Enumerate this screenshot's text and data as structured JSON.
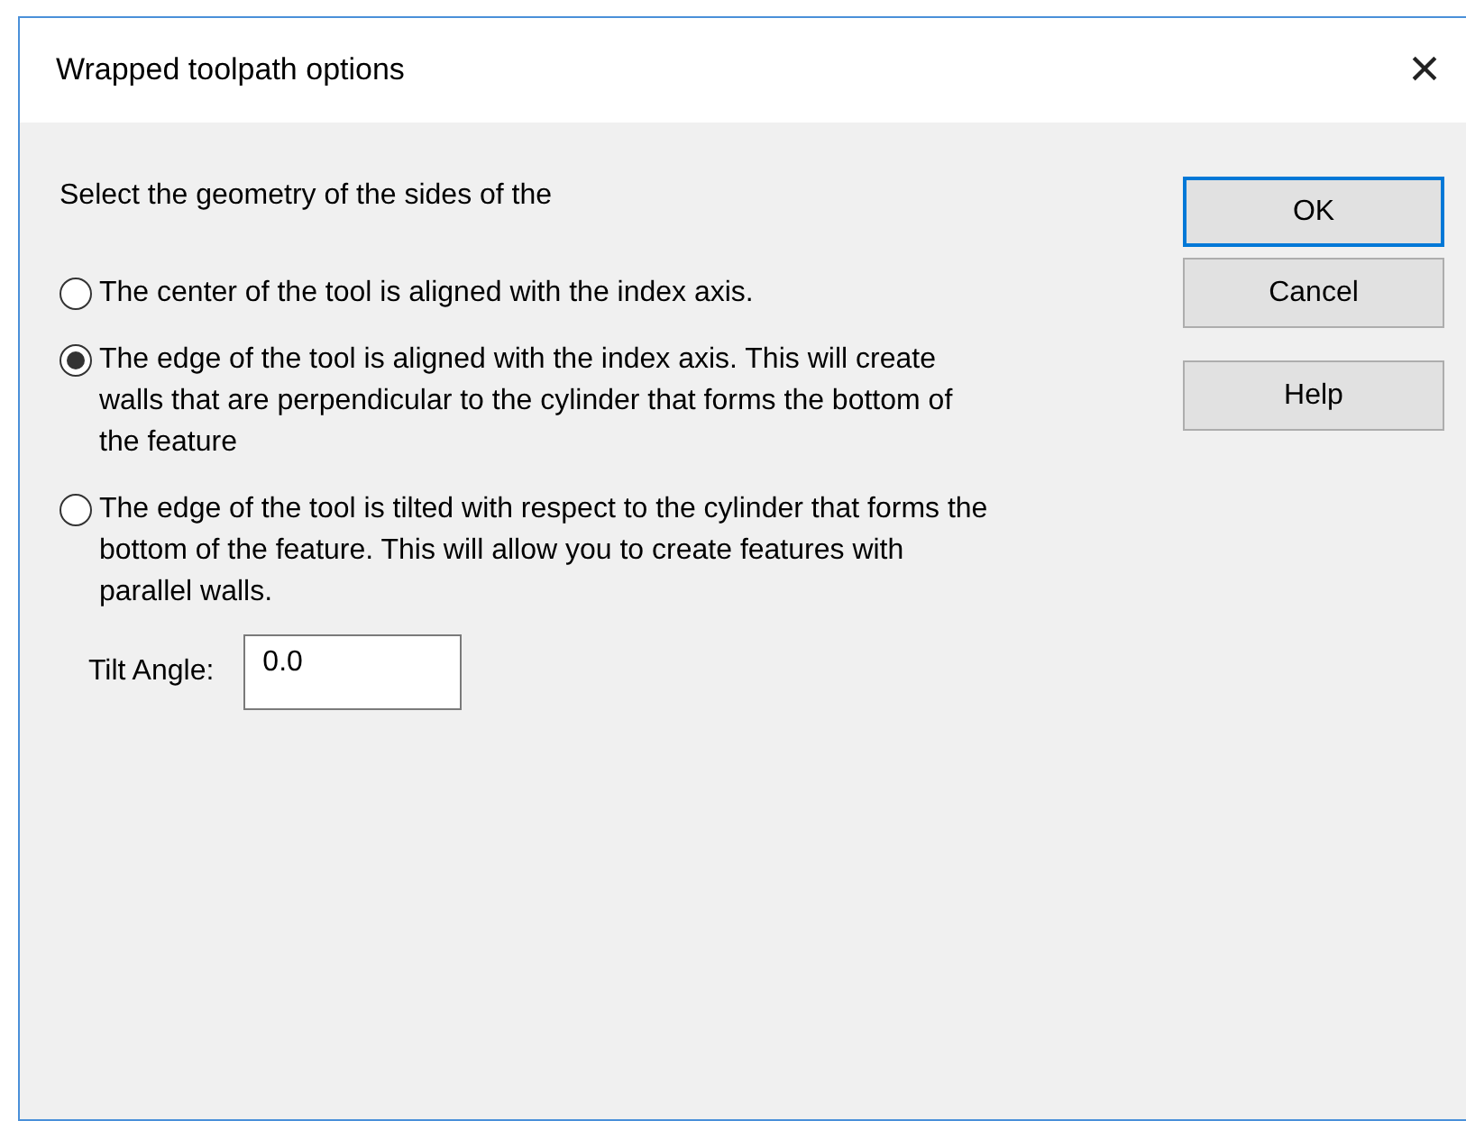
{
  "window": {
    "title": "Wrapped toolpath options",
    "close": "×"
  },
  "prompt": "Select the geometry of the sides of the",
  "options": [
    {
      "label": "The center of the tool is aligned with the index axis.",
      "selected": false
    },
    {
      "label": "The edge of the tool is aligned with the index axis.  This will create walls that are perpendicular to the cylinder that forms the bottom of the feature",
      "selected": true
    },
    {
      "label": "The edge of the tool is tilted with respect to the cylinder that forms the bottom of the feature.  This will allow you to create features with parallel walls.",
      "selected": false
    }
  ],
  "tilt_angle": {
    "label": "Tilt Angle:",
    "value": "0.0"
  },
  "buttons": [
    {
      "label": "OK",
      "default": true
    },
    {
      "label": "Cancel",
      "default": false
    },
    {
      "label": "Help",
      "default": false
    }
  ]
}
